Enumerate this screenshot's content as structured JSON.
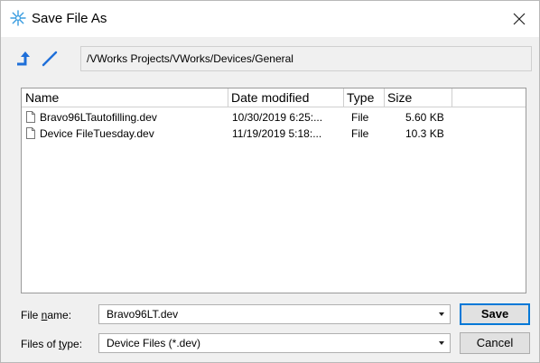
{
  "window": {
    "title": "Save File As"
  },
  "toolbar": {
    "path": "/VWorks Projects/VWorks/Devices/General"
  },
  "columns": {
    "name": "Name",
    "date": "Date modified",
    "type": "Type",
    "size": "Size"
  },
  "files": [
    {
      "name": "Bravo96LTautofilling.dev",
      "date": "10/30/2019 6:25:...",
      "type": "File",
      "size": "5.60 KB"
    },
    {
      "name": "Device FileTuesday.dev",
      "date": "11/19/2019 5:18:...",
      "type": "File",
      "size": "10.3 KB"
    }
  ],
  "form": {
    "filename_label_pre": "File ",
    "filename_label_accel": "n",
    "filename_label_post": "ame:",
    "filename_value": "Bravo96LT.dev",
    "filetype_label_pre": "Files of ",
    "filetype_label_accel": "t",
    "filetype_label_post": "ype:",
    "filetype_value": "Device Files (*.dev)"
  },
  "buttons": {
    "save": "Save",
    "cancel": "Cancel"
  },
  "colors": {
    "accent": "#0078d7",
    "icon_blue": "#1e6fd9"
  }
}
